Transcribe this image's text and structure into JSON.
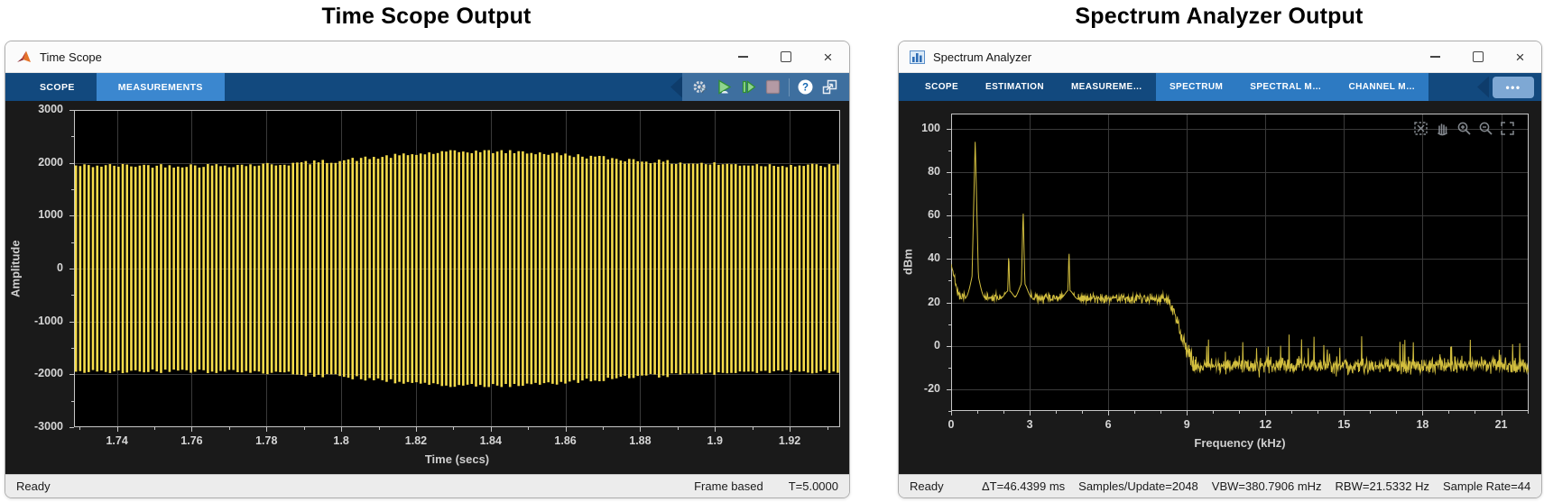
{
  "headings": {
    "left": "Time Scope Output",
    "right": "Spectrum Analyzer Output"
  },
  "time_scope": {
    "window_title": "Time Scope",
    "window_controls": [
      "minimize",
      "maximize",
      "close"
    ],
    "tabs": [
      {
        "label": "SCOPE",
        "selected": false
      },
      {
        "label": "MEASUREMENTS",
        "selected": true
      }
    ],
    "toolbar_icons": [
      "settings-icon",
      "run-icon",
      "step-forward-icon",
      "stop-icon",
      "divider",
      "help-icon",
      "dock-icon"
    ],
    "status": {
      "left": "Ready",
      "right": [
        "Frame based",
        "T=5.0000"
      ]
    }
  },
  "spectrum_analyzer": {
    "window_title": "Spectrum Analyzer",
    "window_controls": [
      "minimize",
      "maximize",
      "close"
    ],
    "tabs": [
      {
        "label": "SCOPE",
        "group": "dark"
      },
      {
        "label": "ESTIMATION",
        "group": "dark"
      },
      {
        "label": "MEASUREME…",
        "group": "dark"
      },
      {
        "label": "SPECTRUM",
        "group": "light"
      },
      {
        "label": "SPECTRAL M…",
        "group": "light"
      },
      {
        "label": "CHANNEL M…",
        "group": "light"
      }
    ],
    "overflow_button": "•••",
    "plot_tool_icons": [
      "fit-view-icon",
      "pan-icon",
      "zoom-in-icon",
      "zoom-out-icon",
      "expand-icon"
    ],
    "status": {
      "left": "Ready",
      "segments": [
        "ΔT=46.4399 ms",
        "Samples/Update=2048",
        "VBW=380.7906 mHz",
        "RBW=21.5332 Hz",
        "Sample Rate=44."
      ]
    }
  },
  "chart_data": [
    {
      "type": "line",
      "name": "time-scope",
      "xlabel": "Time (secs)",
      "ylabel": "Amplitude",
      "xlim": [
        1.7285,
        1.9335
      ],
      "ylim": [
        -3000,
        3000
      ],
      "xtick_labels": [
        "1.74",
        "1.76",
        "1.78",
        "1.8",
        "1.82",
        "1.84",
        "1.86",
        "1.88",
        "1.9",
        "1.92"
      ],
      "ytick_labels": [
        "3000",
        "2000",
        "1000",
        "0",
        "-1000",
        "-2000",
        "-3000"
      ],
      "x_minor_step": 0.01,
      "y_minor_step": 500,
      "grid_color": "#3a3a3a",
      "frame_color": "#c6c6c6",
      "bg": "#000000",
      "series": [
        {
          "name": "channel-1",
          "color": "#f6dc4b",
          "kind": "dense-sine-symmetric-envelope",
          "cycles": 180,
          "envelope_base": 1960,
          "envelope_peak": 2240,
          "envelope_min": 1880
        }
      ]
    },
    {
      "type": "line",
      "name": "spectrum",
      "xlabel": "Frequency (kHz)",
      "ylabel": "dBm",
      "xlim": [
        0,
        22.05
      ],
      "ylim": [
        -30,
        107
      ],
      "xtick_labels": [
        "0",
        "3",
        "6",
        "9",
        "12",
        "15",
        "18",
        "21"
      ],
      "ytick_labels": [
        "100",
        "80",
        "60",
        "40",
        "20",
        "0",
        "-20"
      ],
      "x_minor_step": 1,
      "y_minor_step": 10,
      "grid_color": "#3a3a3a",
      "frame_color": "#c6c6c6",
      "bg": "#000000",
      "series": [
        {
          "name": "spectrum-trace",
          "color": "#d2be3e",
          "start_dbm": 38,
          "passband_dbm": 22,
          "rolloff_start_khz": 8.1,
          "rolloff_end_khz": 9.4,
          "stopband_dbm": -9,
          "noise_sigma_passband": 1.7,
          "noise_sigma_stopband": 2.6,
          "peaks": [
            {
              "f_khz": 0.92,
              "dbm": 95
            },
            {
              "f_khz": 2.2,
              "dbm": 44
            },
            {
              "f_khz": 2.75,
              "dbm": 63
            },
            {
              "f_khz": 4.5,
              "dbm": 45
            }
          ]
        }
      ]
    }
  ]
}
